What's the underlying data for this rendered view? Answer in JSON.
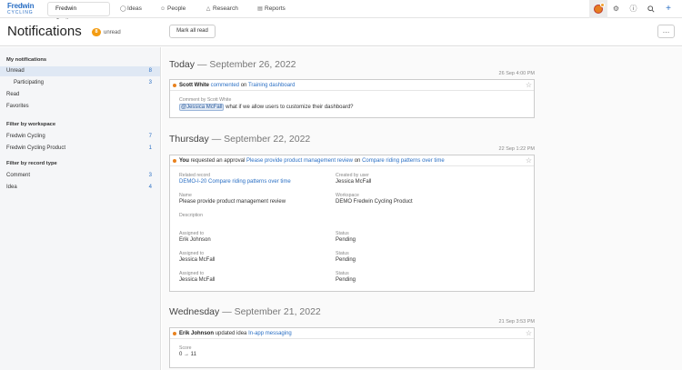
{
  "nav": {
    "logo_line1": "Fredwin",
    "logo_line2": "CYCLING",
    "workspace": "Fredwin Cycling",
    "items": [
      {
        "label": "Ideas",
        "icon": "lightbulb-icon"
      },
      {
        "label": "People",
        "icon": "person-icon"
      },
      {
        "label": "Research",
        "icon": "flask-icon"
      },
      {
        "label": "Reports",
        "icon": "bar-chart-icon"
      }
    ],
    "right_icons": [
      "avatar",
      "settings-icon",
      "help-icon",
      "search-icon",
      "plus-icon"
    ]
  },
  "header": {
    "title": "Notifications",
    "unread_count": "8",
    "unread_label": "unread",
    "mark_all_read": "Mark all read",
    "more": "…"
  },
  "sidebar": {
    "my_notifications": "My notifications",
    "items": [
      {
        "label": "Unread",
        "count": "8"
      },
      {
        "label": "Participating",
        "count": "3"
      },
      {
        "label": "Read",
        "count": ""
      },
      {
        "label": "Favorites",
        "count": ""
      }
    ],
    "filter_workspace": "Filter by workspace",
    "workspaces": [
      {
        "label": "Fredwin Cycling",
        "count": "7"
      },
      {
        "label": "Fredwin Cycling Product",
        "count": "1"
      }
    ],
    "filter_record": "Filter by record type",
    "record_types": [
      {
        "label": "Comment",
        "count": "3"
      },
      {
        "label": "Idea",
        "count": "4"
      }
    ]
  },
  "groups": [
    {
      "day": "Today",
      "date": "— September 26, 2022",
      "timestamp": "26 Sep 4:00 PM",
      "actor": "Scott White",
      "verb": "commented",
      "preposition": "on",
      "target": "Training dashboard",
      "comment_by": "Comment by Scott White",
      "mention": "@Jessica McFall",
      "comment_text": "what if we allow users to customize their dashboard?"
    },
    {
      "day": "Thursday",
      "date": "— September 22, 2022",
      "timestamp": "22 Sep 1:22 PM",
      "actor": "You",
      "verb": "requested an approval",
      "target": "Please provide product management review",
      "preposition": "on",
      "target2": "Compare riding patterns over time",
      "fields": {
        "related_record_label": "Related record",
        "related_record": "DEMO-I-20 Compare riding patterns over time",
        "created_by_label": "Created by user",
        "created_by": "Jessica McFall",
        "name_label": "Name",
        "name": "Please provide product management review",
        "workspace_label": "Workspace",
        "workspace": "DEMO Fredwin Cycling Product",
        "description_label": "Description",
        "assignments": [
          {
            "assigned_label": "Assigned to",
            "assigned": "Erik Johnson",
            "status_label": "Status",
            "status": "Pending"
          },
          {
            "assigned_label": "Assigned to",
            "assigned": "Jessica McFall",
            "status_label": "Status",
            "status": "Pending"
          },
          {
            "assigned_label": "Assigned to",
            "assigned": "Jessica McFall",
            "status_label": "Status",
            "status": "Pending"
          }
        ]
      }
    },
    {
      "day": "Wednesday",
      "date": "— September 21, 2022",
      "timestamp": "21 Sep 3:53 PM",
      "actor": "Erik Johnson",
      "verb": "updated idea",
      "target": "In-app messaging",
      "score_label": "Score",
      "score_change": "0 → 11"
    }
  ],
  "colors": {
    "accent": "#2a6fc4",
    "unread_dot": "#e8821e",
    "badge": "#f39c12",
    "active_sidebar": "#dfe8f4"
  }
}
